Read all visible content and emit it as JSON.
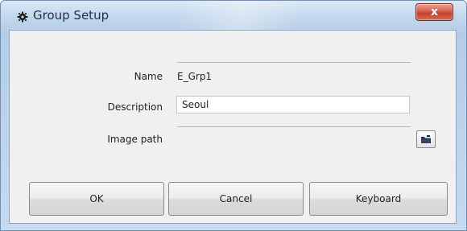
{
  "window": {
    "title": "Group Setup",
    "close_label": "x"
  },
  "form": {
    "name_label": "Name",
    "name_value": "E_Grp1",
    "description_label": "Description",
    "description_value": "Seoul",
    "image_path_label": "Image path",
    "image_path_value": ""
  },
  "buttons": {
    "ok": "OK",
    "cancel": "Cancel",
    "keyboard": "Keyboard"
  },
  "icons": {
    "title": "gear-icon",
    "browse": "folder-icon",
    "close": "close-icon"
  },
  "colors": {
    "close_button": "#d5604c",
    "title_text": "#1f2f46"
  }
}
